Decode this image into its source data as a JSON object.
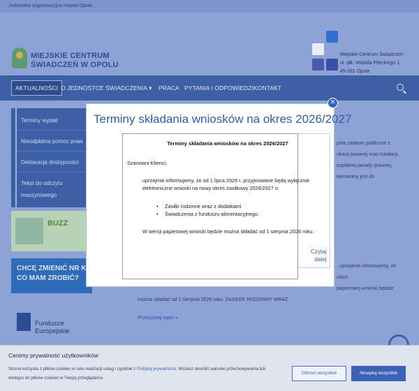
{
  "topbar": {
    "text": "Jednostka organizacyjna miasta Opola"
  },
  "logo": {
    "line1": "MIEJSKIE CENTRUM",
    "line2": "ŚWIADCZEŃ W OPOLU"
  },
  "address": {
    "line1": "Miejskie Centrum Świadczeń",
    "line2": "ul. płk. Witolda Pileckiego 1",
    "line3": "45-331 Opole"
  },
  "nav": {
    "items": [
      "AKTUALNOŚCI",
      "O JEDNOSTCE",
      "ŚWIADCZENIA ▾",
      "PRACA",
      "PYTANIA I ODPOWIEDZI",
      "KONTAKT"
    ]
  },
  "sidebar": {
    "items": [
      "Terminy wypłat",
      "Nieodpłatna pomoc praw",
      "Deklaracja dostępności",
      "Tekst do odczytu",
      "maszynowego"
    ]
  },
  "promo": {
    "buzz": "BUZZ",
    "change_line1": "CHCĘ ZMIENIĆ NR K",
    "change_line2": "CO MAM ZROBIĆ?"
  },
  "eu": {
    "line1": "Fundusze",
    "line2": "Europejskie"
  },
  "main_fragments": {
    "r1": "pola zadanie publiczne z",
    "r2": "ukacji prawnej oraz mediacji.",
    "r3": "ezpłatnej porady prawnej,",
    "r4": "kierowany jest do",
    "r5": ", uprzejmie informujemy, że",
    "r6": "odzić",
    "r7": "papierowej wnioski będzie",
    "r8": "można składać od 1 sierpnia 2026 roku. ZASIŁEK RODZINNY WRAZ"
  },
  "read_more": "Przeczytaj wpis »",
  "modal": {
    "title": "Terminy składania wniosków na okres 2026/2027",
    "doc_title": "Terminy składania wniosków na okres 2026/2027",
    "greeting": "Szanowni Klienci,",
    "para1_line1": "uprzejmie informujemy, że od 1 lipca 2026 r. przyjmowane będą wyłącznie",
    "para1_line2": "elektroniczne wnioski na nowy okres zasiłkowy 2026/2027 o:",
    "bullets": [
      "Zasiłki rodzinne wraz z dodatkami",
      "Świadczenia z funduszu alimentacyjnego."
    ],
    "para2": "W wersji papierowej wnioski będzie można składać od 1 sierpnia 2026 roku.",
    "more_line1": "Czytaj",
    "more_line2": "dalej",
    "close": "✕"
  },
  "cookie": {
    "title": "Cenimy prywatność użytkowników",
    "text1_a": "Strona korzysta z plików cookies w celu realizacji usług i zgodnie z ",
    "text1_link": "Polityką prywatności",
    "text1_b": ". Możesz określić warunki przechowywania lub",
    "text2": "dostępu do plików cookies w Twojej przeglądarce.",
    "reject": "Odrzuć wszystkie",
    "accept": "Akceptuj wszystkie"
  },
  "colors": {
    "nav": "#3d5fa6",
    "accent": "#2f5cae",
    "accept": "#3d62b5"
  }
}
